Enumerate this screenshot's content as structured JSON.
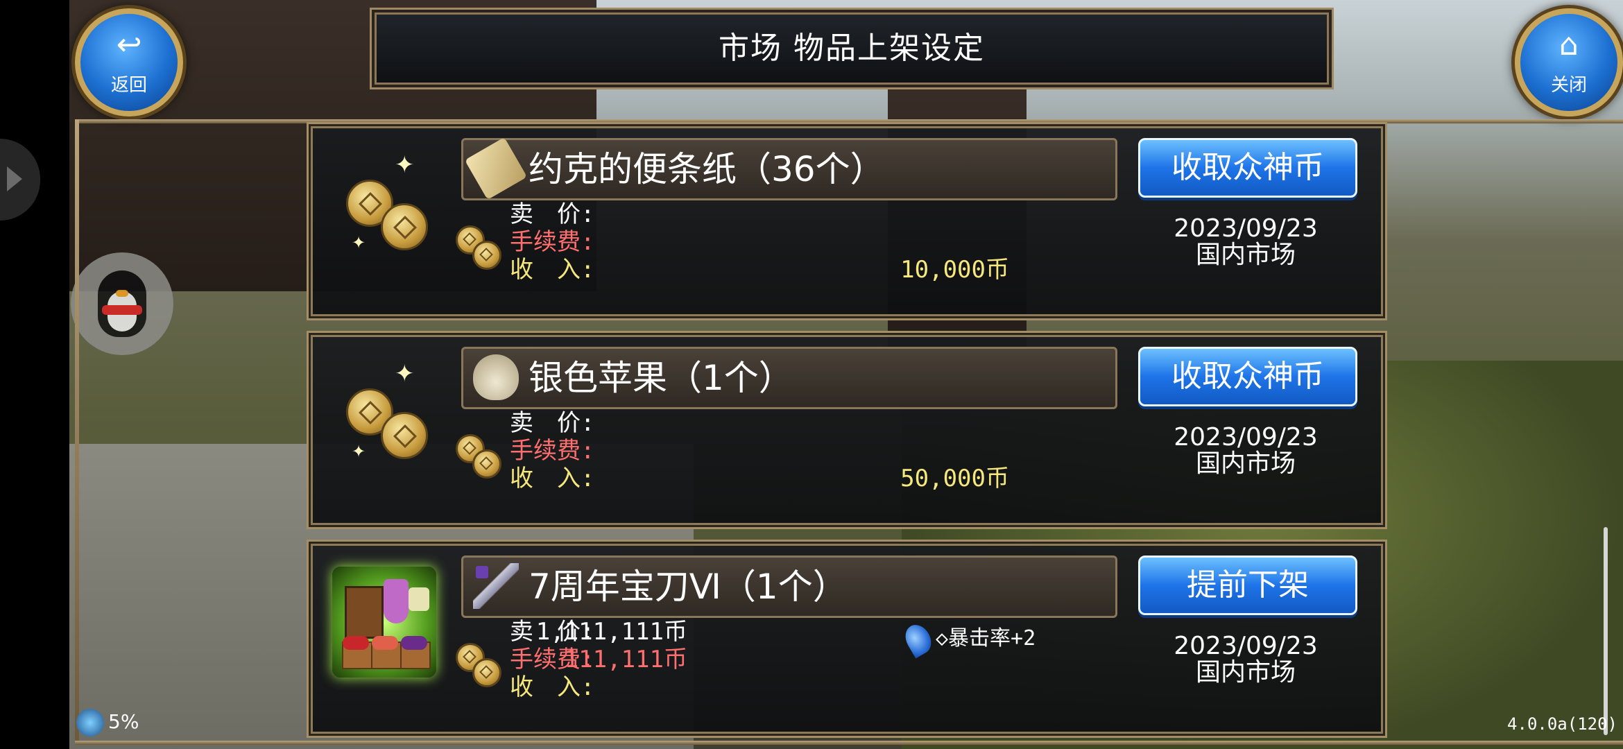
{
  "header": {
    "title": "市场  物品上架设定",
    "back_label": "返回",
    "close_label": "关闭"
  },
  "listings": [
    {
      "name": "约克的便条纸（36个）",
      "icon": "paper-scroll-icon",
      "action": "收取众神币",
      "price_label": "卖　价:",
      "price_value": "",
      "fee_label": "手续费:",
      "fee_value": "",
      "income_label": "收　入:",
      "income_value": "10,000币",
      "date": "2023/09/23",
      "market": "国内市场"
    },
    {
      "name": "银色苹果（1个）",
      "icon": "silver-bag-icon",
      "action": "收取众神币",
      "price_label": "卖　价:",
      "price_value": "",
      "fee_label": "手续费:",
      "fee_value": "",
      "income_label": "收　入:",
      "income_value": "50,000币",
      "date": "2023/09/23",
      "market": "国内市场"
    },
    {
      "name": "7周年宝刀Ⅵ（1个）",
      "icon": "sword-icon",
      "action": "提前下架",
      "price_label": "卖　价:",
      "price_value": "1,111,111币",
      "fee_label": "手续费:",
      "fee_value": "111,111币",
      "income_label": "收　入:",
      "income_value": "",
      "bonus": "◇暴击率+2",
      "date": "2023/09/23",
      "market": "国内市场"
    }
  ],
  "footer": {
    "percent": "5%",
    "version": "4.0.0a(120)"
  },
  "colors": {
    "button_blue": "#1e74e8",
    "fee_red": "#ff6f6f",
    "income_yellow": "#f6e87c",
    "frame_gold": "#a48e66"
  }
}
